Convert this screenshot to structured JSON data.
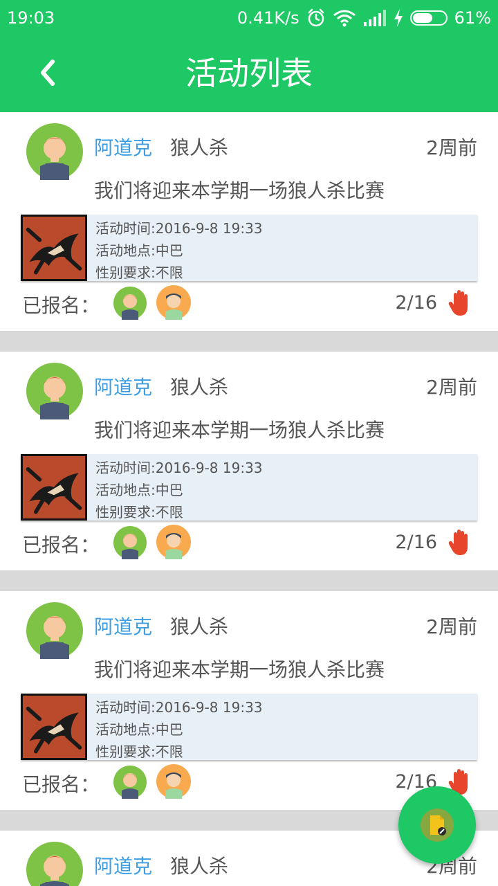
{
  "status_bar": {
    "time": "19:03",
    "speed": "0.41K/s",
    "battery_percent": "61%",
    "battery_level": 0.61,
    "icons": [
      "alarm-icon",
      "wifi-icon",
      "signal-icon",
      "charging-icon",
      "battery-icon"
    ]
  },
  "app_bar": {
    "title": "活动列表",
    "back_icon": "chevron-left-icon"
  },
  "activities": [
    {
      "author": "阿道克",
      "category": "狼人杀",
      "time_ago": "2周前",
      "description": "我们将迎来本学期一场狼人杀比赛",
      "time_line": "活动时间:2016-9-8 19:33",
      "place_line": "活动地点:中巴",
      "gender_line": "性别要求:不限",
      "signed_label": "已报名：",
      "count": "2/16"
    },
    {
      "author": "阿道克",
      "category": "狼人杀",
      "time_ago": "2周前",
      "description": "我们将迎来本学期一场狼人杀比赛",
      "time_line": "活动时间:2016-9-8 19:33",
      "place_line": "活动地点:中巴",
      "gender_line": "性别要求:不限",
      "signed_label": "已报名：",
      "count": "2/16"
    },
    {
      "author": "阿道克",
      "category": "狼人杀",
      "time_ago": "2周前",
      "description": "我们将迎来本学期一场狼人杀比赛",
      "time_line": "活动时间:2016-9-8 19:33",
      "place_line": "活动地点:中巴",
      "gender_line": "性别要求:不限",
      "signed_label": "已报名：",
      "count": "2/16"
    },
    {
      "author": "阿道克",
      "category": "狼人杀",
      "time_ago": "2周前"
    }
  ],
  "colors": {
    "brand_green": "#1ec864",
    "author_blue": "#3d9ee3",
    "hand_red": "#e8462c",
    "info_bg": "#e8f0f7"
  },
  "fab": {
    "icon": "new-document-icon"
  }
}
